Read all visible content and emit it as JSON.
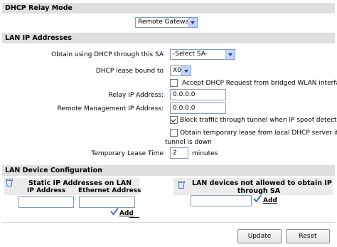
{
  "relay_mode": {
    "section_title": "DHCP Relay Mode",
    "mode_value": "Remote Gateway"
  },
  "lan_ip": {
    "section_title": "LAN IP Addresses",
    "obtain_label": "Obtain using DHCP through this SA",
    "obtain_value": "-Select SA-",
    "lease_bound_label": "DHCP lease bound to",
    "lease_bound_value": "X0",
    "accept_dhcp_label": "Accept DHCP Request from bridged WLAN interface",
    "accept_dhcp_checked": false,
    "relay_ip_label": "Relay IP Address:",
    "relay_ip_value": "0.0.0.0",
    "remote_mgmt_label": "Remote Management IP Address:",
    "remote_mgmt_value": "0.0.0.0",
    "block_traffic_label": "Block traffic through tunnel when IP spoof detected",
    "block_traffic_checked": true,
    "obtain_temp_label_line1": "Obtain temporary lease from local DHCP server if",
    "obtain_temp_label_line2": "tunnel is down",
    "obtain_temp_checked": false,
    "temp_lease_label": "Temporary Lease Time",
    "temp_lease_value": "2",
    "temp_lease_unit": "minutes"
  },
  "lan_device": {
    "section_title": "LAN Device Configuration",
    "static_title": "Static IP Addresses on LAN",
    "col_ip": "IP Address",
    "col_eth": "Ethernet Address",
    "static_add_label": "Add",
    "not_allowed_title_line1": "LAN devices not allowed to obtain IP",
    "not_allowed_title_line2": "through SA",
    "not_allowed_add_label": "Add"
  },
  "buttons": {
    "update": "Update",
    "reset": "Reset"
  },
  "colors": {
    "section_bg": "#dfdfdf",
    "checkmark": "#3a78c8"
  }
}
